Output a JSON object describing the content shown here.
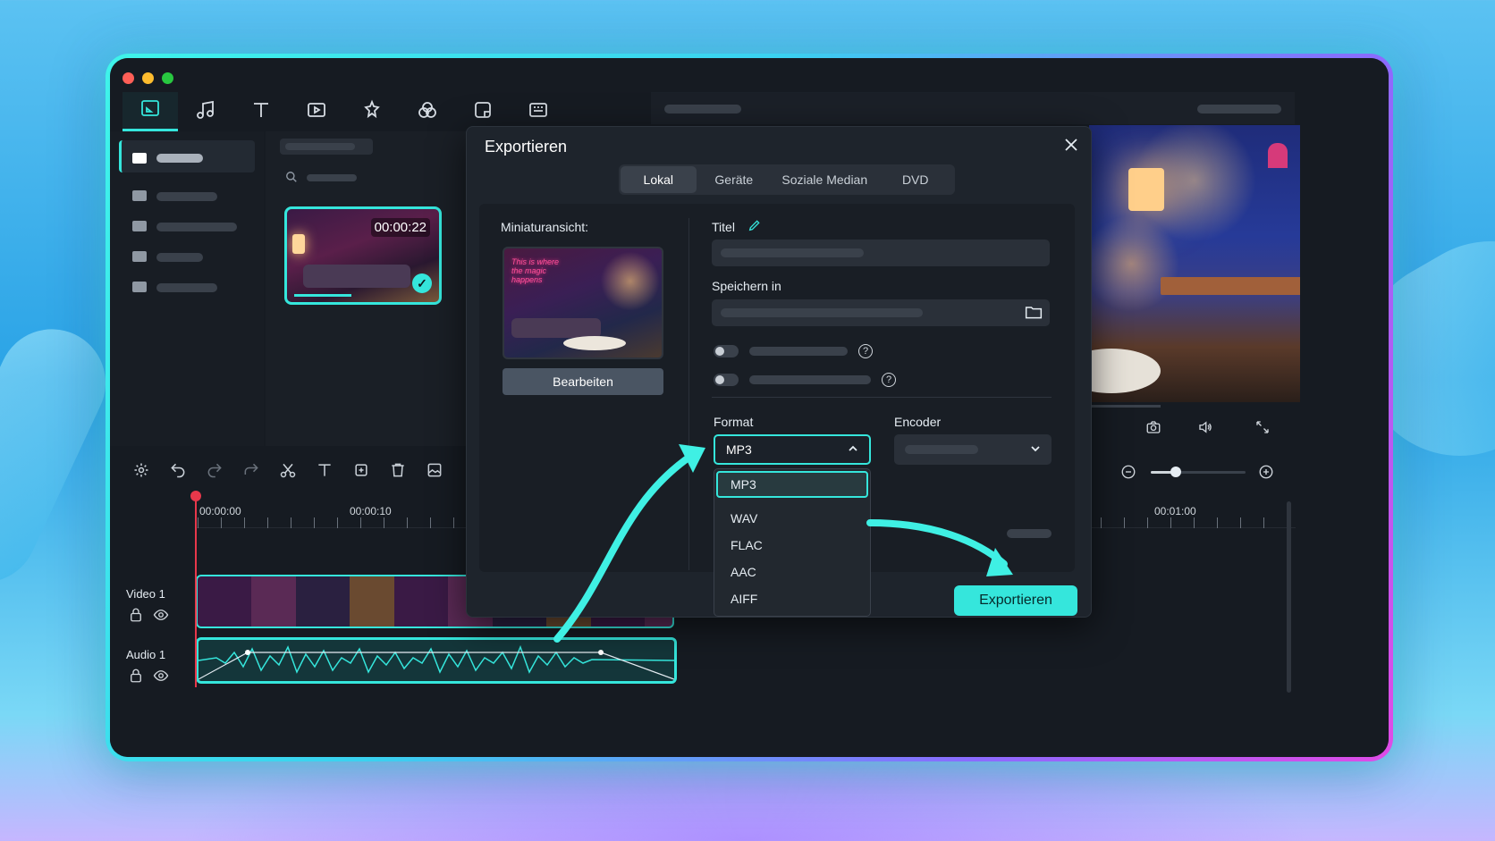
{
  "window": {
    "controls": [
      "close",
      "minimize",
      "maximize"
    ]
  },
  "toolbar": {
    "icons": [
      "media-icon",
      "music-icon",
      "text-icon",
      "video-transition-icon",
      "effects-icon",
      "filters-icon",
      "stickers-icon",
      "templates-icon"
    ]
  },
  "media": {
    "clip_duration": "00:00:22"
  },
  "timeline": {
    "ruler": [
      "00:00:00",
      "00:00:10",
      "00:01:00"
    ],
    "tracks": {
      "video": "Video 1",
      "audio": "Audio 1"
    }
  },
  "dialog": {
    "title": "Exportieren",
    "tabs": [
      "Lokal",
      "Geräte",
      "Soziale Median",
      "DVD"
    ],
    "active_tab": "Lokal",
    "thumbnail_label": "Miniaturansicht:",
    "thumbnail_neon_text": "This is where the magic happens",
    "edit_button": "Bearbeiten",
    "title_label": "Titel",
    "save_label": "Speichern in",
    "format_label": "Format",
    "encoder_label": "Encoder",
    "format_value": "MP3",
    "format_options": [
      "MP3",
      "WAV",
      "FLAC",
      "AAC",
      "AIFF"
    ],
    "export_button": "Exportieren"
  },
  "colors": {
    "accent": "#35e6dc",
    "playhead": "#e8384b"
  }
}
